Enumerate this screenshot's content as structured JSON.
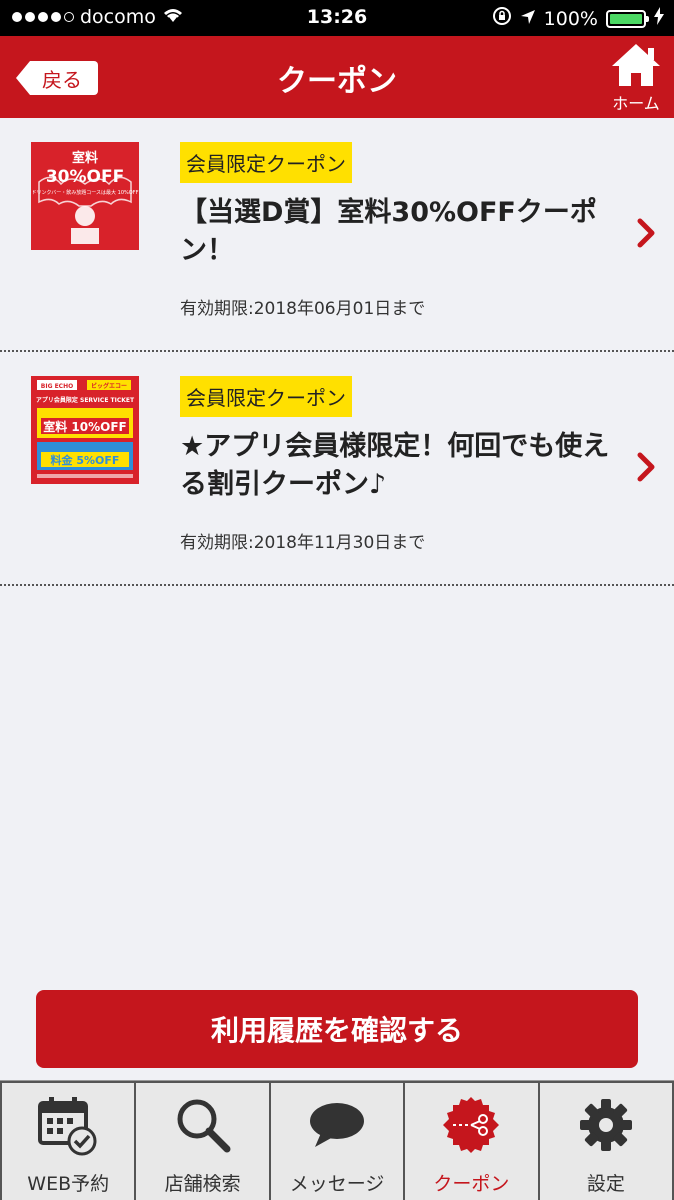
{
  "status_bar": {
    "carrier": "docomo",
    "time": "13:26",
    "battery": "100%"
  },
  "nav": {
    "back_label": "戻る",
    "title": "クーポン",
    "home_label": "ホーム"
  },
  "coupons": [
    {
      "badge": "会員限定クーポン",
      "title": "【当選D賞】室料30%OFFクーポン！",
      "expiry": "有効期限:2018年06月01日まで",
      "thumb": {
        "heading": "室料",
        "discount": "30%OFF",
        "note": "ドリンクバー・飲み放題コースは最大 10%OFF"
      }
    },
    {
      "badge": "会員限定クーポン",
      "title": "★アプリ会員様限定！何回でも使える割引クーポン♪",
      "expiry": "有効期限:2018年11月30日まで",
      "thumb": {
        "brand1": "BIG ECHO",
        "brand2": "ビッグエコー",
        "ticket": "アプリ会員限定 SERVICE TICKET",
        "line1": "室料 10%OFF",
        "line2": "料金 5%OFF"
      }
    }
  ],
  "history_button": "利用履歴を確認する",
  "tabs": [
    {
      "label": "WEB予約",
      "icon": "calendar-check-icon"
    },
    {
      "label": "店舗検索",
      "icon": "search-icon"
    },
    {
      "label": "メッセージ",
      "icon": "speech-bubble-icon"
    },
    {
      "label": "クーポン",
      "icon": "coupon-scissors-icon",
      "active": true
    },
    {
      "label": "設定",
      "icon": "gear-icon"
    }
  ],
  "colors": {
    "brand_red": "#c5161d",
    "badge_yellow": "#ffe000",
    "background": "#f0f1f5"
  }
}
